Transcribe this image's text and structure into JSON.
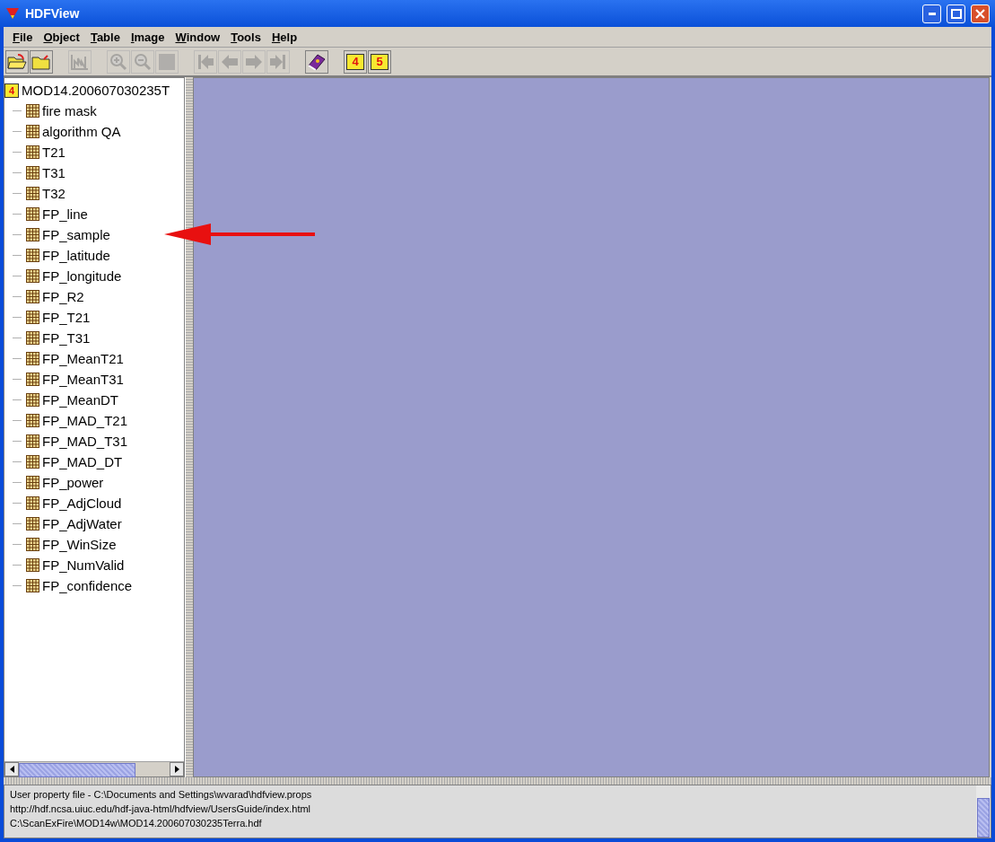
{
  "window": {
    "title": "HDFView"
  },
  "menu": [
    {
      "label": "File"
    },
    {
      "label": "Object"
    },
    {
      "label": "Table"
    },
    {
      "label": "Image"
    },
    {
      "label": "Window"
    },
    {
      "label": "Tools"
    },
    {
      "label": "Help"
    }
  ],
  "toolbar": [
    {
      "kind": "open",
      "disabled": false
    },
    {
      "kind": "open-remote",
      "disabled": false
    },
    {
      "kind": "sep"
    },
    {
      "kind": "chart",
      "disabled": true
    },
    {
      "kind": "sep"
    },
    {
      "kind": "zoom-in",
      "disabled": true
    },
    {
      "kind": "zoom-out",
      "disabled": true
    },
    {
      "kind": "blank",
      "disabled": true
    },
    {
      "kind": "sep"
    },
    {
      "kind": "first",
      "disabled": true
    },
    {
      "kind": "prev",
      "disabled": true
    },
    {
      "kind": "next",
      "disabled": true
    },
    {
      "kind": "last",
      "disabled": true
    },
    {
      "kind": "sep"
    },
    {
      "kind": "help",
      "disabled": false
    },
    {
      "kind": "sep"
    },
    {
      "kind": "folder",
      "label": "4",
      "disabled": false
    },
    {
      "kind": "folder",
      "label": "5",
      "disabled": false
    }
  ],
  "tree": {
    "root": {
      "label": "MOD14.200607030235T",
      "badge": "4",
      "children": [
        {
          "label": "fire mask"
        },
        {
          "label": "algorithm QA"
        },
        {
          "label": "T21"
        },
        {
          "label": "T31"
        },
        {
          "label": "T32"
        },
        {
          "label": "FP_line"
        },
        {
          "label": "FP_sample"
        },
        {
          "label": "FP_latitude"
        },
        {
          "label": "FP_longitude"
        },
        {
          "label": "FP_R2"
        },
        {
          "label": "FP_T21"
        },
        {
          "label": "FP_T31"
        },
        {
          "label": "FP_MeanT21"
        },
        {
          "label": "FP_MeanT31"
        },
        {
          "label": "FP_MeanDT"
        },
        {
          "label": "FP_MAD_T21"
        },
        {
          "label": "FP_MAD_T31"
        },
        {
          "label": "FP_MAD_DT"
        },
        {
          "label": "FP_power"
        },
        {
          "label": "FP_AdjCloud"
        },
        {
          "label": "FP_AdjWater"
        },
        {
          "label": "FP_WinSize"
        },
        {
          "label": "FP_NumValid"
        },
        {
          "label": "FP_confidence"
        }
      ]
    }
  },
  "log": [
    "User property file - C:\\Documents and Settings\\wvarad\\hdfview.props",
    "http://hdf.ncsa.uiuc.edu/hdf-java-html/hdfview/UsersGuide/index.html",
    "C:\\ScanExFire\\MOD14w\\MOD14.200607030235Terra.hdf"
  ]
}
